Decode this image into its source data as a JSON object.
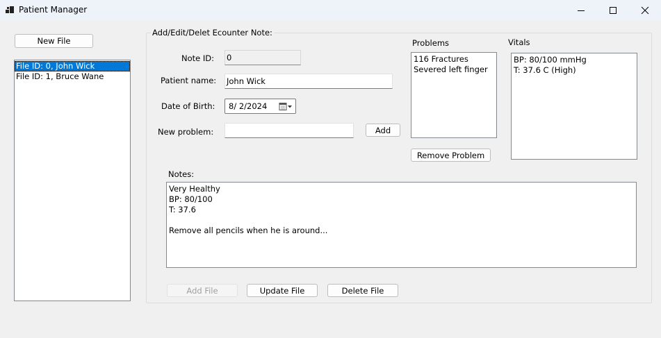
{
  "window": {
    "title": "Patient Manager",
    "minimize_icon": "minimize-icon",
    "maximize_icon": "maximize-icon",
    "close_icon": "close-icon"
  },
  "left_panel": {
    "new_file_label": "New File",
    "files": [
      {
        "label": "File ID: 0, John Wick",
        "selected": true
      },
      {
        "label": "File ID: 1, Bruce Wane",
        "selected": false
      }
    ]
  },
  "note_group": {
    "caption": "Add/Edit/Delet Ecounter Note:",
    "note_id_label": "Note ID:",
    "note_id_value": "0",
    "patient_name_label": "Patient name:",
    "patient_name_value": "John Wick",
    "dob_label": "Date of Birth:",
    "dob_value": "8/  2/2024",
    "new_problem_label": "New problem:",
    "new_problem_value": "",
    "add_label": "Add",
    "problems_label": "Problems",
    "problems": [
      "116 Fractures",
      "Severed left finger"
    ],
    "remove_problem_label": "Remove Problem",
    "vitals_label": "Vitals",
    "vitals": [
      "BP: 80/100 mmHg",
      "T: 37.6 C (High)"
    ],
    "notes_label": "Notes:",
    "notes_text": "Very Healthy\nBP: 80/100\nT: 37.6\n\nRemove all pencils when he is around...",
    "add_file_label": "Add File",
    "update_file_label": "Update File",
    "delete_file_label": "Delete File"
  },
  "colors": {
    "selection": "#0078d7",
    "titlebar": "#eef3fa",
    "window_bg": "#f0f0f0"
  }
}
